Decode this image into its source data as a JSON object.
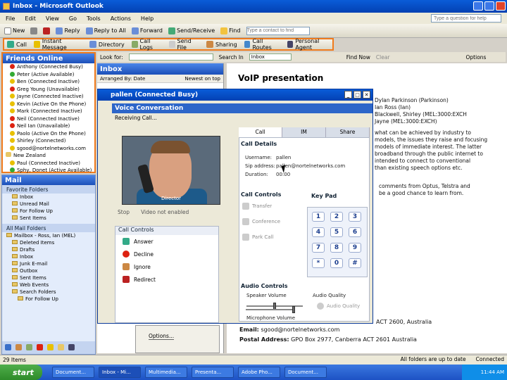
{
  "window": {
    "title": "Inbox - Microsoft Outlook",
    "ask_placeholder": "Type a question for help"
  },
  "menu": [
    "File",
    "Edit",
    "View",
    "Go",
    "Tools",
    "Actions",
    "Help"
  ],
  "toolbar1": {
    "new": "New",
    "reply": "Reply",
    "reply_all": "Reply to All",
    "forward": "Forward",
    "send_receive": "Send/Receive",
    "find": "Find",
    "find_contact": "Type a contact to find"
  },
  "toolbar2": {
    "call": "Call",
    "instant_message": "Instant Message",
    "directory": "Directory",
    "call_logs": "Call Logs",
    "send_file": "Send File",
    "sharing": "Sharing",
    "call_routes": "Call Routes",
    "personal_agent": "Personal Agent"
  },
  "friends": {
    "title": "Friends Online",
    "items": [
      {
        "label": "Anthony (Connected Busy)",
        "color": "#d21"
      },
      {
        "label": "Peter (Active Available)",
        "color": "#3a3"
      },
      {
        "label": "Ben (Connected Inactive)",
        "color": "#e8c000"
      },
      {
        "label": "Greg Young (Unavailable)",
        "color": "#d21"
      },
      {
        "label": "Jayne (Connected Inactive)",
        "color": "#e8c000"
      },
      {
        "label": "Kevin (Active On the Phone)",
        "color": "#e8c000"
      },
      {
        "label": "Mark (Connected Inactive)",
        "color": "#e8c000"
      },
      {
        "label": "Neil (Connected Inactive)",
        "color": "#d21"
      },
      {
        "label": "Neil Ian (Unavailable)",
        "color": "#d21"
      },
      {
        "label": "Paolo (Active On the Phone)",
        "color": "#e8c000"
      },
      {
        "label": "Shirley (Connected)",
        "color": "#e8c000"
      },
      {
        "label": "sgood@nortelnetworks.com",
        "color": "#e8c000"
      }
    ],
    "group": "New Zealand",
    "group_items": [
      {
        "label": "Paul (Connected Inactive)",
        "color": "#e8c000"
      },
      {
        "label": "Sphy, Donet (Active Available)",
        "color": "#3a3"
      }
    ]
  },
  "mail": {
    "title": "Mail",
    "favorites_header": "Favorite Folders",
    "favorites": [
      "Inbox",
      "Unread Mail",
      "For Follow Up",
      "Sent Items"
    ],
    "all_header": "All Mail Folders",
    "mailbox": "Mailbox - Ross, Ian (MEL)",
    "folders": [
      "Deleted Items",
      "Drafts",
      "Inbox",
      "Junk E-mail",
      "Outbox",
      "Sent Items",
      "Web Events",
      "Search Folders",
      "For Follow Up"
    ]
  },
  "findbar": {
    "look_for": "Look for:",
    "search_in": "Search In",
    "search_value": "Inbox",
    "find_now": "Find Now",
    "clear": "Clear",
    "options": "Options"
  },
  "inbox": {
    "title": "Inbox",
    "arranged": "Arranged By: Date",
    "order": "Newest on top"
  },
  "reading": {
    "title": "VoIP presentation",
    "lines": [
      "Dylan Parkinson (Parkinson)",
      "Ian Ross (Ian)",
      "Blackwell, Shirley (MEL:3000:EXCH",
      "Jayne (MEL:3000:EXCH)",
      "what can be achieved by industry to",
      "models, the issues they raise and focusing",
      "models of immediate interest. The latter",
      "broadband through the public internet to",
      "intended to connect to conventional",
      "than existing speech options etc.",
      "comments from Optus, Telstra and",
      "be a good chance to learn from."
    ],
    "email_label": "Email:",
    "email_value": "sgood@nortelnetworks.com",
    "email_tail": "ACT 2600, Australia",
    "postal_label": "Postal Address:",
    "postal_value": "GPO Box 2977, Canberra ACT 2601 Australia"
  },
  "pwindow": {
    "title": "pallen (Connected Busy)",
    "header": "Voice Conversation",
    "receiving": "Receiving Call...",
    "caption": "Director",
    "stop": "Stop",
    "video_status": "Video not enabled",
    "tabs": [
      "Call",
      "IM",
      "Share"
    ],
    "call_details": "Call Details",
    "username_label": "Username:",
    "username": "pallen",
    "sip_label": "Sip address:",
    "sip": "pallen@nortelnetworks.com",
    "duration_label": "Duration:",
    "duration": "00:00",
    "call_controls": "Call Controls",
    "transfer": "Transfer",
    "conference": "Conference",
    "park": "Park Call",
    "keypad": "Key Pad",
    "keys": [
      "1",
      "2",
      "3",
      "4",
      "5",
      "6",
      "7",
      "8",
      "9",
      "*",
      "0",
      "#"
    ],
    "audio_controls": "Audio Controls",
    "speaker": "Speaker Volume",
    "quality": "Audio Quality",
    "audio_quality_btn": "Audio Quality",
    "mic": "Microphone Volume",
    "left_controls_header": "Call Controls",
    "answer": "Answer",
    "decline": "Decline",
    "ignore": "Ignore",
    "redirect": "Redirect"
  },
  "dialog_behind": {
    "options": "Options..."
  },
  "status": {
    "items": "29 Items",
    "sync": "All folders are up to date",
    "connection": "Connected"
  },
  "taskbar": {
    "start": "start",
    "buttons": [
      "Document...",
      "Inbox - Mi...",
      "Multimedia...",
      "Presenta...",
      "Adobe Pho...",
      "Document..."
    ],
    "time": "11:44 AM"
  }
}
